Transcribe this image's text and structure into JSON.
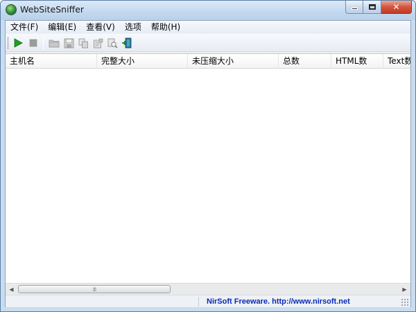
{
  "window": {
    "title": "WebSiteSniffer",
    "icon": "globe-sniffer-icon",
    "controls": [
      "minimize-icon",
      "maximize-icon",
      "close-icon"
    ],
    "close_glyph": "✕"
  },
  "menu": {
    "items": [
      {
        "label": "文件(F)"
      },
      {
        "label": "编辑(E)"
      },
      {
        "label": "查看(V)"
      },
      {
        "label": "选项"
      },
      {
        "label": "帮助(H)"
      }
    ]
  },
  "toolbar": {
    "buttons": [
      {
        "icon": "play-icon",
        "enabled": true
      },
      {
        "icon": "stop-icon",
        "enabled": false
      },
      {
        "icon": "open-folder-icon",
        "enabled": false
      },
      {
        "icon": "save-icon",
        "enabled": false
      },
      {
        "icon": "copy-icon",
        "enabled": false
      },
      {
        "icon": "properties-icon",
        "enabled": false
      },
      {
        "icon": "find-icon",
        "enabled": false
      },
      {
        "icon": "exit-icon",
        "enabled": true
      }
    ]
  },
  "table": {
    "columns": [
      "主机名",
      "完整大小",
      "未压缩大小",
      "总数",
      "HTML数",
      "Text数"
    ],
    "rows": []
  },
  "scrollbar": {
    "grip": "⁞⁞⁞",
    "left_arrow": "◀",
    "right_arrow": "▶"
  },
  "status": {
    "link_text": "NirSoft Freeware.  http://www.nirsoft.net"
  },
  "colors": {
    "play": "#1fa01f",
    "link": "#0a2ab8",
    "close_button": "#c33a22"
  }
}
